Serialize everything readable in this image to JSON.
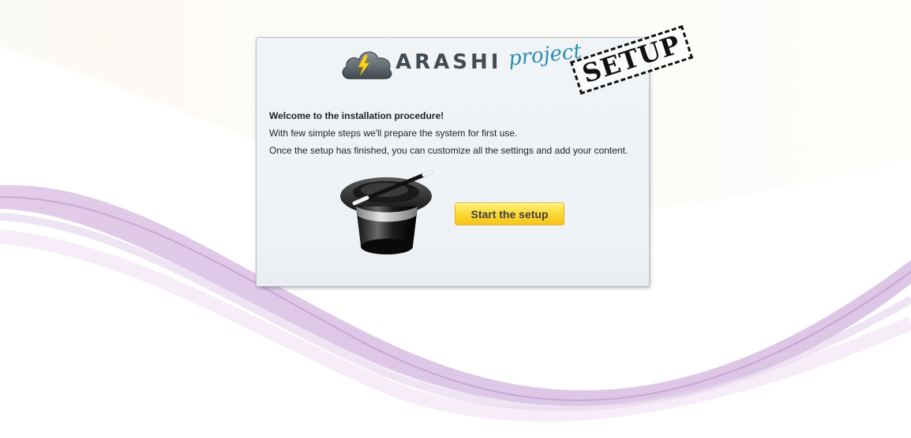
{
  "logo": {
    "brand": "ARASHI",
    "tagline": "project",
    "stamp": "SETUP",
    "icon": "storm-cloud-icon"
  },
  "welcome": {
    "heading": "Welcome to the installation procedure!",
    "line1": "With few simple steps we'll prepare the system for first use.",
    "line2": "Once the setup has finished, you can customize all the settings and add your content."
  },
  "illustration": {
    "icon": "magic-hat-icon"
  },
  "actions": {
    "start_label": "Start the setup"
  },
  "colors": {
    "brand_text": "#424b52",
    "tagline": "#2a8fb3",
    "button_top": "#fff27a",
    "button_bottom": "#f6c41b",
    "wave_purple": "#b98fc9"
  }
}
